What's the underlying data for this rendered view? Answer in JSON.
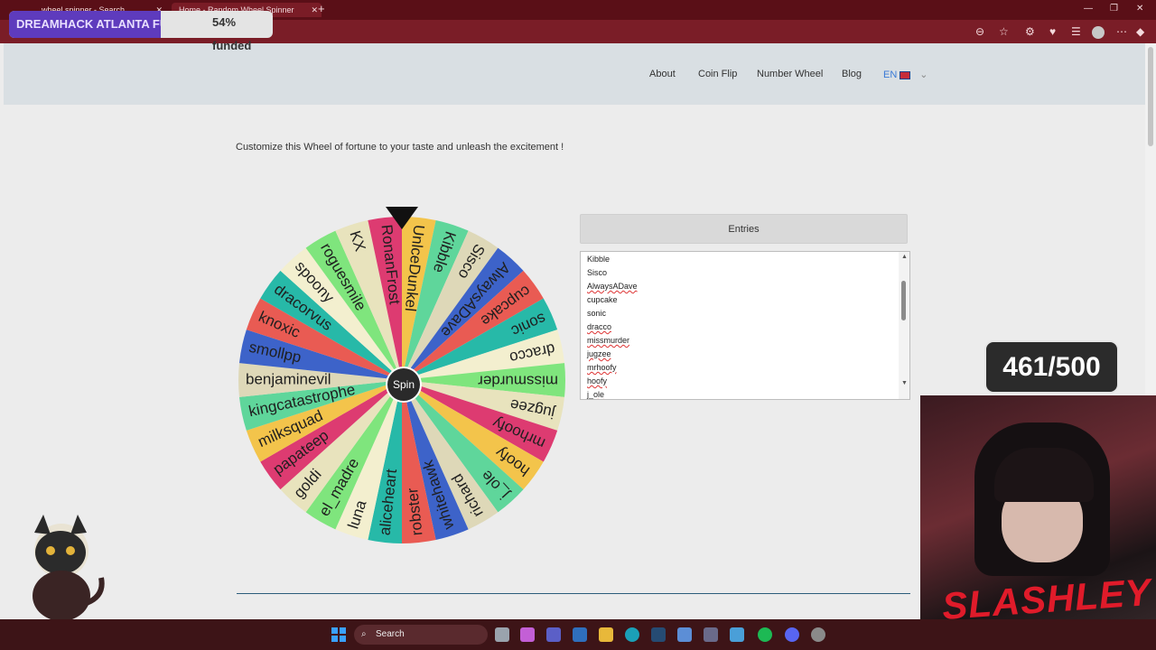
{
  "browser": {
    "tabs": [
      {
        "label": "wheel spinner - Search"
      },
      {
        "label": "Home - Random Wheel Spinner"
      }
    ],
    "new_tab": "+"
  },
  "overlay": {
    "funding_label": "DREAMHACK ATLANTA FU...",
    "funding_percent": "54% funded",
    "counter": "461/500",
    "streamer_logo": "SLASHLEY"
  },
  "nav": {
    "items": [
      {
        "label": "About"
      },
      {
        "label": "Coin Flip"
      },
      {
        "label": "Number Wheel"
      },
      {
        "label": "Blog"
      }
    ],
    "language": "EN"
  },
  "main": {
    "tagline": "Customize this Wheel of fortune to your taste and unleash the excitement !",
    "entries_button": "Entries",
    "entries": [
      "Kibble",
      "Sisco",
      "AlwaysADave",
      "cupcake",
      "sonic",
      "dracco",
      "missmurder",
      "jugzee",
      "mrhoofy",
      "hoofy",
      "j_ole"
    ],
    "spin_label": "Spin"
  },
  "wheel": {
    "labels": [
      "UnlceDunkel",
      "Kibble",
      "Sisco",
      "AlwaysADave",
      "cupcake",
      "sonic",
      "dracco",
      "missmurder",
      "jugzee",
      "mrhoofy",
      "hoofy",
      "j_ole",
      "richard",
      "whitehawk",
      "robster",
      "aliceheart",
      "luna",
      "el_madre",
      "goldi",
      "papateep",
      "milksquad",
      "kingcatastrophe",
      "benjaminevil",
      "smollpp",
      "knoxic",
      "dracorvus",
      "spoony",
      "roguesmile",
      "KX",
      "RonanFrost"
    ],
    "colors": [
      "#f3c44b",
      "#5fd69b",
      "#ded8b8",
      "#3d63c9",
      "#e95b53",
      "#27b9a8",
      "#f3efcf",
      "#7fe57d",
      "#e8e3bd",
      "#dd3b71",
      "#f3c44b",
      "#5fd69b",
      "#ded8b8",
      "#3d63c9",
      "#e95b53",
      "#27b9a8",
      "#f3efcf",
      "#7fe57d",
      "#e8e3bd",
      "#dd3b71",
      "#f3c44b",
      "#5fd69b",
      "#ded8b8",
      "#3d63c9",
      "#e95b53",
      "#27b9a8",
      "#f3efcf",
      "#7fe57d",
      "#e8e3bd",
      "#dd3b71"
    ],
    "pointer_color": "#111111"
  },
  "taskbar": {
    "search_label": "Search"
  }
}
